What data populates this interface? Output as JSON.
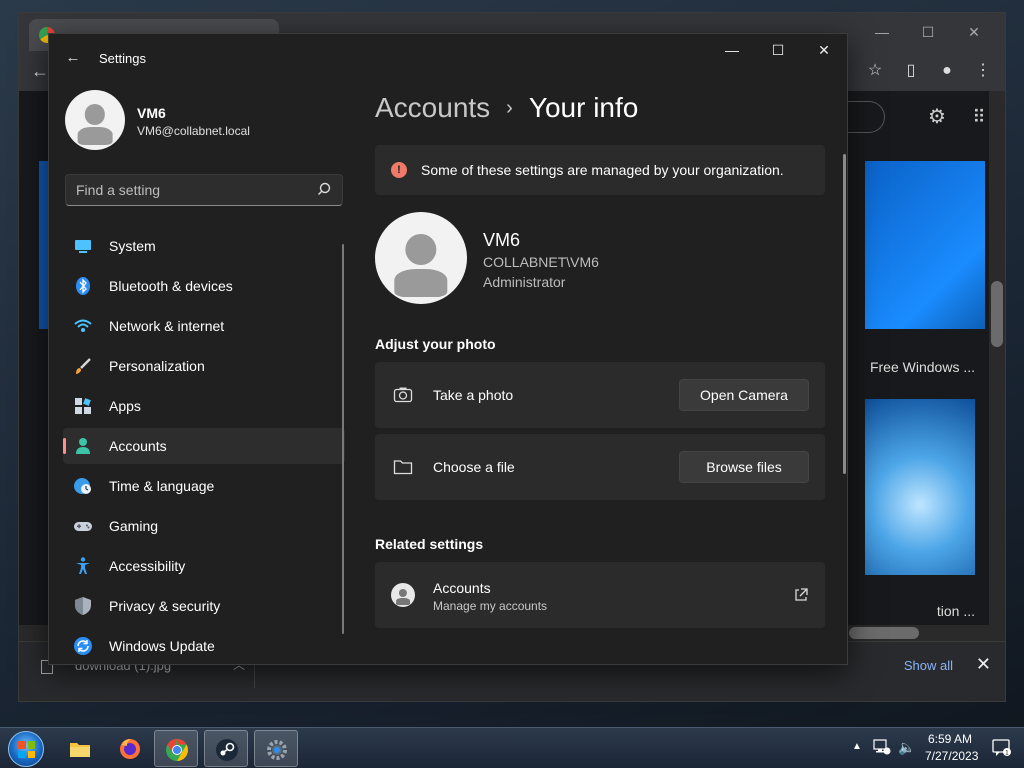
{
  "browser": {
    "tab_title": "",
    "thumb1_caption": "Free Windows ...",
    "thumb2_caption": "tion ...",
    "downloads": {
      "file_name": "download (1).jpg",
      "show_all_label": "Show all"
    }
  },
  "settings": {
    "window_title": "Settings",
    "profile": {
      "name": "VM6",
      "email": "VM6@collabnet.local"
    },
    "search": {
      "placeholder": "Find a setting"
    },
    "nav": [
      {
        "label": "System",
        "icon": "system-icon"
      },
      {
        "label": "Bluetooth & devices",
        "icon": "bluetooth-icon"
      },
      {
        "label": "Network & internet",
        "icon": "wifi-icon"
      },
      {
        "label": "Personalization",
        "icon": "brush-icon"
      },
      {
        "label": "Apps",
        "icon": "apps-icon"
      },
      {
        "label": "Accounts",
        "icon": "accounts-icon",
        "active": true
      },
      {
        "label": "Time & language",
        "icon": "globe-clock-icon"
      },
      {
        "label": "Gaming",
        "icon": "gamepad-icon"
      },
      {
        "label": "Accessibility",
        "icon": "accessibility-icon"
      },
      {
        "label": "Privacy & security",
        "icon": "shield-icon"
      },
      {
        "label": "Windows Update",
        "icon": "update-icon"
      }
    ],
    "breadcrumb": {
      "parent": "Accounts",
      "current": "Your info"
    },
    "managed_banner": "Some of these settings are managed by your organization.",
    "user": {
      "name": "VM6",
      "domain": "COLLABNET\\VM6",
      "role": "Administrator"
    },
    "adjust_photo": {
      "title": "Adjust your photo",
      "take_photo_label": "Take a photo",
      "open_camera_label": "Open Camera",
      "choose_file_label": "Choose a file",
      "browse_files_label": "Browse files"
    },
    "related": {
      "title": "Related settings",
      "accounts_label": "Accounts",
      "accounts_sub": "Manage my accounts"
    }
  },
  "taskbar": {
    "time": "6:59 AM",
    "date": "7/27/2023"
  },
  "colors": {
    "accent": "#ff8f8f",
    "info": "#f07a6a",
    "window_bg": "#202020",
    "card_bg": "#2b2b2b"
  }
}
